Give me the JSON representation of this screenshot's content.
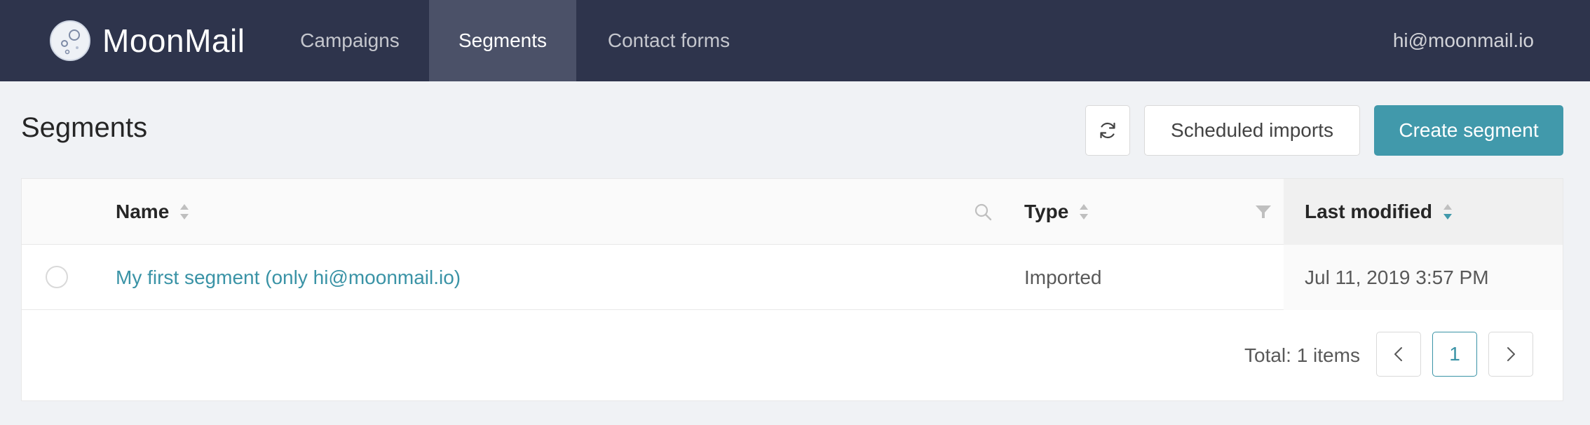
{
  "app": {
    "name": "MoonMail"
  },
  "nav": {
    "items": [
      {
        "label": "Campaigns",
        "active": false
      },
      {
        "label": "Segments",
        "active": true
      },
      {
        "label": "Contact forms",
        "active": false
      }
    ],
    "user_email": "hi@moonmail.io"
  },
  "page": {
    "title": "Segments",
    "buttons": {
      "refresh_icon": "refresh-icon",
      "scheduled_imports": "Scheduled imports",
      "create_segment": "Create segment"
    }
  },
  "table": {
    "columns": [
      {
        "label": "Name",
        "sortable": true,
        "searchable": true
      },
      {
        "label": "Type",
        "sortable": true,
        "filterable": true
      },
      {
        "label": "Last modified",
        "sortable": true,
        "sorted": "descending"
      }
    ],
    "rows": [
      {
        "name": "My first segment (only hi@moonmail.io)",
        "type": "Imported",
        "last_modified": "Jul 11, 2019 3:57 PM",
        "selected": false
      }
    ]
  },
  "pagination": {
    "total_text": "Total: 1 items",
    "current_page": "1"
  },
  "colors": {
    "navbar": "#2e344c",
    "nav_active": "#4b5168",
    "accent": "#4199ab",
    "link": "#3a93a6",
    "background": "#f0f2f5"
  }
}
